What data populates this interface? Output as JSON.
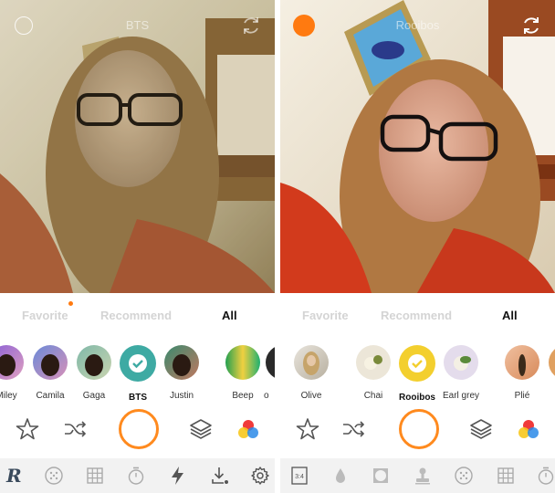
{
  "left": {
    "photo_title": "BTS",
    "tabs": {
      "favorite": "Favorite",
      "recommend": "Recommend",
      "all": "All"
    },
    "filters": [
      "Miley",
      "Camila",
      "Gaga",
      "BTS",
      "Justin",
      "Beep",
      "o"
    ],
    "selected_filter": "BTS"
  },
  "right": {
    "photo_title": "Rooibos",
    "tabs": {
      "favorite": "Favorite",
      "recommend": "Recommend",
      "all": "All"
    },
    "filters": [
      "Olive",
      "Chai",
      "Rooibos",
      "Earl grey",
      "Plié"
    ],
    "selected_filter": "Rooibos",
    "toolbar_ratio": "3:4"
  },
  "colors": {
    "accent": "#ff7a10",
    "tab_inactive": "#d4d4d4",
    "toolbar_bg": "#f2f2f2"
  }
}
